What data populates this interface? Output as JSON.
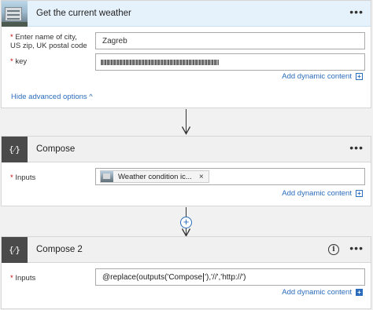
{
  "weather_card": {
    "title": "Get the current weather",
    "menu": "•••",
    "fields": [
      {
        "required_mark": "*",
        "label_line1": "Enter name of city,",
        "label_line2": "US zip, UK postal code",
        "value": "Zagreb"
      },
      {
        "required_mark": "*",
        "label_line1": "key",
        "value": ""
      }
    ],
    "dynamic_content": "Add dynamic content",
    "dynamic_plus": "+",
    "advanced": "Hide advanced options ^"
  },
  "compose1": {
    "title": "Compose",
    "icon_glyph": "{⁄}",
    "menu": "•••",
    "inputs_required_mark": "*",
    "inputs_label": "Inputs",
    "token_text": "Weather condition ic...",
    "token_remove": "×",
    "dynamic_content": "Add dynamic content",
    "dynamic_plus": "+"
  },
  "add_step": "+",
  "compose2": {
    "title": "Compose 2",
    "icon_glyph": "{⁄}",
    "info": "i",
    "menu": "•••",
    "inputs_required_mark": "*",
    "inputs_label": "Inputs",
    "expression_before_caret": "@replace(outputs('Compose",
    "expression_after_caret": "'),'//','http://')",
    "dynamic_content": "Add dynamic content",
    "dynamic_plus": "+"
  },
  "colors": {
    "link": "#2b6cbc",
    "required": "#cc0000",
    "header_blue": "#e6f2fb",
    "header_gray": "#f0f0f0"
  }
}
